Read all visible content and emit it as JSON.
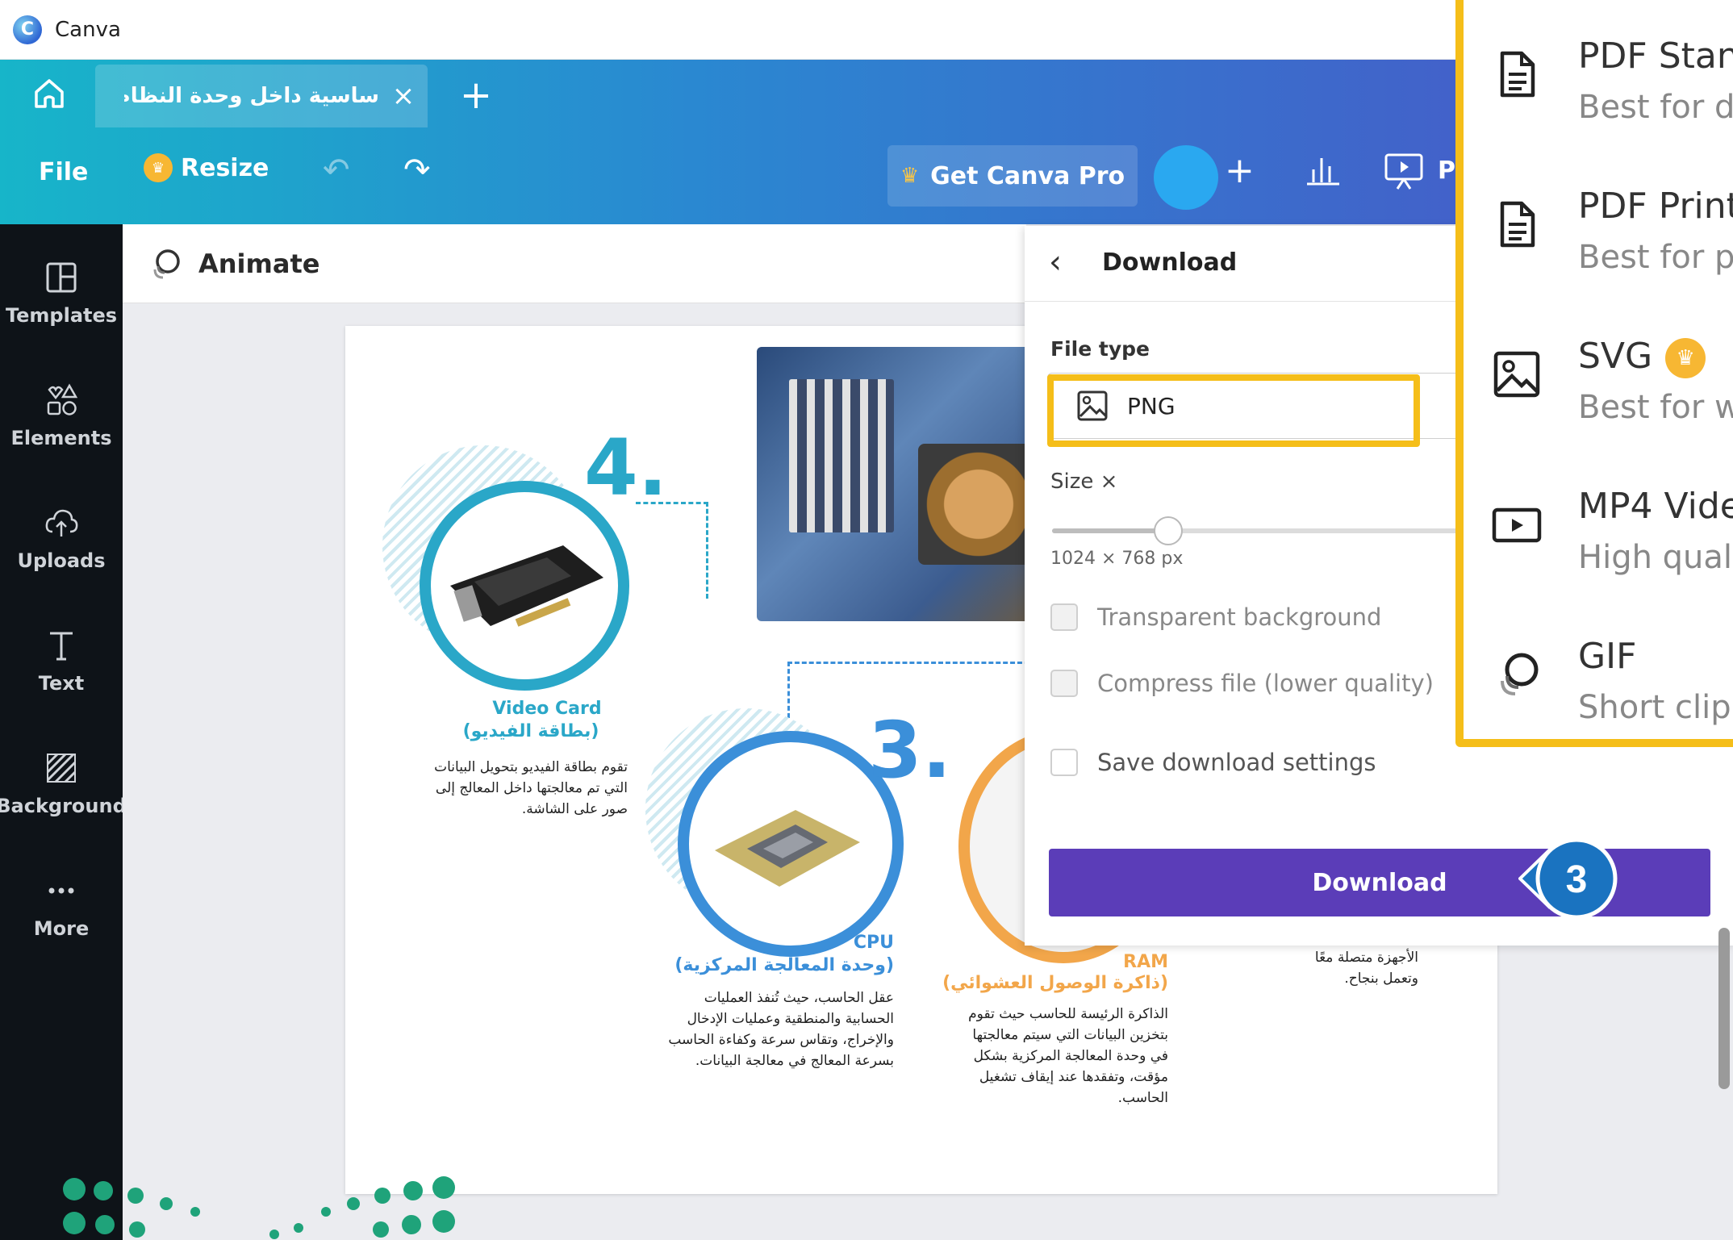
{
  "app": {
    "title": "Canva"
  },
  "tabs": {
    "document_title": "ساسية داخل وحدة النظام...",
    "close_glyph": "×",
    "add_glyph": "+"
  },
  "toolbar": {
    "file_label": "File",
    "resize_label": "Resize",
    "pro_label": "Get Canva Pro",
    "plus_glyph": "+",
    "present_label": "P"
  },
  "sidebar": {
    "items": [
      {
        "label": "Templates",
        "icon": "templates-icon"
      },
      {
        "label": "Elements",
        "icon": "elements-icon"
      },
      {
        "label": "Uploads",
        "icon": "uploads-icon"
      },
      {
        "label": "Text",
        "icon": "text-icon"
      },
      {
        "label": "Background",
        "icon": "background-icon"
      },
      {
        "label": "More",
        "icon": "more-icon"
      }
    ]
  },
  "editor": {
    "animate_label": "Animate"
  },
  "slide": {
    "video_card": {
      "number": "4.",
      "title_en": "Video Card",
      "title_ar": "(بطاقة الفيديو)",
      "body": "تقوم بطاقة الفيديو بتحويل البيانات التي تم معالجتها داخل المعالج إلى صور على الشاشة."
    },
    "cpu": {
      "number": "3.",
      "title_en": "CPU",
      "title_ar": "(وحدة المعالجة المركزية)",
      "body": "عقل الحاسب، حيث تُنفذ العمليات الحسابية والمنطقية وعمليات الإدخال والإخراج، وتقاس سرعة وكفاءة الحاسب بسرعة المعالج في معالجة البيانات."
    },
    "ram": {
      "title_en": "RAM",
      "title_ar": "(ذاكرة الوصول العشوائي)",
      "body": "الذاكرة الرئيسة للحاسب حيث تقوم بتخزين البيانات التي سيتم معالجتها في وحدة المعالجة المركزية بشكل مؤقت، وتفقدها عند إيقاف تشغيل الحاسب."
    },
    "fourth": {
      "body": "الأجهزة متصلة معًا وتعمل بنجاح."
    }
  },
  "download_panel": {
    "title": "Download",
    "file_type_label": "File type",
    "file_type_value": "PNG",
    "size_label": "Size ×",
    "size_value": "1024 × 768 px",
    "size_fraction": 0.18,
    "options": [
      {
        "label": "Transparent background",
        "checked": false,
        "disabled": true
      },
      {
        "label": "Compress file (lower quality)",
        "checked": false,
        "disabled": true
      },
      {
        "label": "Save download settings",
        "checked": false,
        "disabled": false
      }
    ],
    "button_label": "Download"
  },
  "step_badge": {
    "number": "3"
  },
  "format_menu": {
    "items": [
      {
        "name": "PDF Stan",
        "desc": "Best for do",
        "icon": "document-icon"
      },
      {
        "name": "PDF Print",
        "desc": "Best for pr",
        "icon": "document-icon"
      },
      {
        "name": "SVG",
        "desc": "Best for we",
        "icon": "image-icon",
        "pro": true
      },
      {
        "name": "MP4 Vide",
        "desc": "High qualit",
        "icon": "video-icon"
      },
      {
        "name": "GIF",
        "desc": "Short clip,",
        "icon": "gif-icon"
      }
    ]
  },
  "colors": {
    "highlight": "#f5be19",
    "download_button": "#5b3db8",
    "badge": "#1a73c0",
    "sidebar": "#0e1318",
    "cyan_accent": "#2aa7c8",
    "blue_accent": "#3b8fd9",
    "orange_accent": "#f2a64a"
  }
}
